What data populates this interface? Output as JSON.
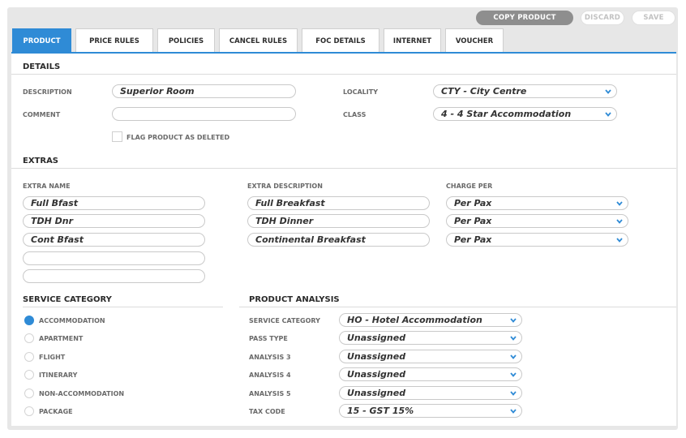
{
  "toolbar": {
    "copy_label": "COPY PRODUCT",
    "discard_label": "DISCARD",
    "save_label": "SAVE"
  },
  "tabs": [
    {
      "label": "PRODUCT",
      "active": true
    },
    {
      "label": "PRICE RULES"
    },
    {
      "label": "POLICIES"
    },
    {
      "label": "CANCEL RULES"
    },
    {
      "label": "FOC DETAILS"
    },
    {
      "label": "INTERNET"
    },
    {
      "label": "VOUCHER"
    }
  ],
  "details": {
    "heading": "DETAILS",
    "description_label": "DESCRIPTION",
    "description_value": "Superior Room",
    "comment_label": "COMMENT",
    "comment_value": "",
    "flag_label": "FLAG PRODUCT AS DELETED",
    "flag_checked": false,
    "locality_label": "LOCALITY",
    "locality_value": "CTY - City Centre",
    "class_label": "CLASS",
    "class_value": "4 - 4 Star Accommodation"
  },
  "extras": {
    "heading": "EXTRAS",
    "col_name": "EXTRA NAME",
    "col_desc": "EXTRA DESCRIPTION",
    "col_charge": "CHARGE PER",
    "rows": [
      {
        "name": "Full Bfast",
        "description": "Full Breakfast",
        "charge": "Per Pax"
      },
      {
        "name": "TDH Dnr",
        "description": "TDH Dinner",
        "charge": "Per Pax"
      },
      {
        "name": "Cont Bfast",
        "description": "Continental Breakfast",
        "charge": "Per Pax"
      },
      {
        "name": ""
      },
      {
        "name": ""
      }
    ]
  },
  "service_category": {
    "heading": "SERVICE CATEGORY",
    "options": [
      {
        "label": "ACCOMMODATION",
        "selected": true
      },
      {
        "label": "APARTMENT",
        "selected": false
      },
      {
        "label": "FLIGHT",
        "selected": false
      },
      {
        "label": "ITINERARY",
        "selected": false
      },
      {
        "label": "NON-ACCOMMODATION",
        "selected": false
      },
      {
        "label": "PACKAGE",
        "selected": false
      }
    ]
  },
  "product_analysis": {
    "heading": "PRODUCT ANALYSIS",
    "rows": [
      {
        "label": "SERVICE CATEGORY",
        "value": "HO - Hotel Accommodation"
      },
      {
        "label": "PASS TYPE",
        "value": "Unassigned"
      },
      {
        "label": "ANALYSIS 3",
        "value": "Unassigned"
      },
      {
        "label": "ANALYSIS 4",
        "value": "Unassigned"
      },
      {
        "label": "ANALYSIS 5",
        "value": "Unassigned"
      },
      {
        "label": "TAX CODE",
        "value": "15 - GST 15%"
      }
    ]
  },
  "colors": {
    "accent": "#2f8bd6",
    "chevron": "#2f8bd6"
  },
  "icons": {
    "dropdown": "chevron-down-icon",
    "radio": "radio-icon",
    "checkbox": "checkbox-icon"
  }
}
